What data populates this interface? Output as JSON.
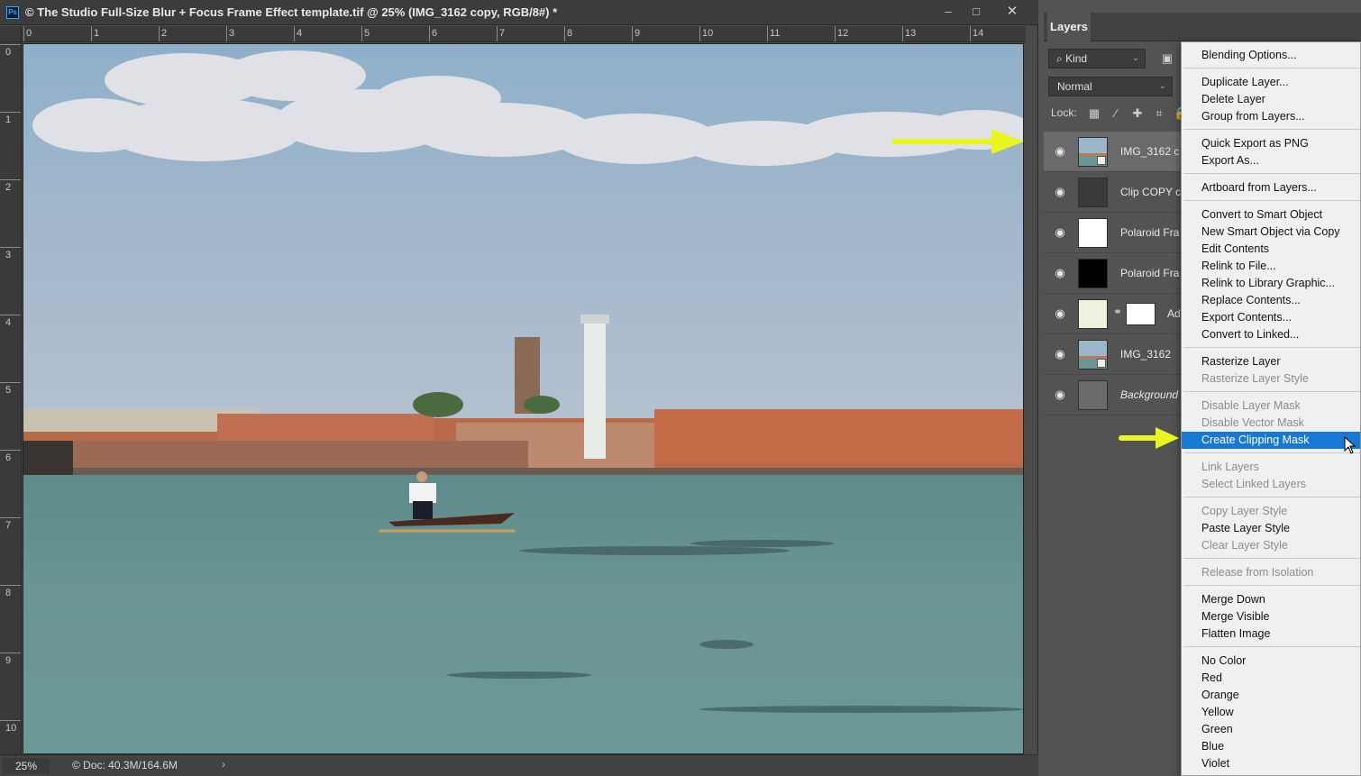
{
  "window": {
    "title": "© The Studio Full-Size Blur + Focus Frame Effect template.tif @ 25% (IMG_3162 copy, RGB/8#) *",
    "app_icon": "ps-app-icon",
    "controls": [
      "minimize-icon",
      "maximize-icon",
      "close-icon"
    ]
  },
  "rulers": {
    "horizontal": [
      "0",
      "1",
      "2",
      "3",
      "4",
      "5",
      "6",
      "7",
      "8",
      "9",
      "10",
      "11",
      "12",
      "13",
      "14"
    ],
    "vertical": [
      "0",
      "1",
      "2",
      "3",
      "4",
      "5",
      "6",
      "7",
      "8",
      "9",
      "10"
    ]
  },
  "status": {
    "zoom": "25%",
    "doc_info": "© Doc: 40.3M/164.6M",
    "expand_arrow": "›"
  },
  "panel": {
    "tab": "Layers",
    "filter_kind": "Kind",
    "filter_icon": "⌕",
    "blend_mode": "Normal",
    "lock_label": "Lock:",
    "lock_icons": [
      "lock-transparent-icon",
      "lock-paint-icon",
      "lock-move-icon",
      "lock-artboard-icon",
      "lock-all-icon"
    ]
  },
  "layers": [
    {
      "name": "IMG_3162 c",
      "selected": true,
      "thumb": "photo",
      "italic": false
    },
    {
      "name": "Clip COPY c",
      "selected": false,
      "thumb": "dark-text",
      "italic": false
    },
    {
      "name": "Polaroid Fra",
      "selected": false,
      "thumb": "white",
      "italic": false
    },
    {
      "name": "Polaroid Fra",
      "selected": false,
      "thumb": "black",
      "italic": false
    },
    {
      "name": "Ad",
      "selected": false,
      "thumb": "adjustment",
      "italic": false
    },
    {
      "name": "IMG_3162",
      "selected": false,
      "thumb": "photo",
      "italic": false
    },
    {
      "name": "Background",
      "selected": false,
      "thumb": "gray",
      "italic": true
    }
  ],
  "context_menu": {
    "groups": [
      [
        {
          "label": "Blending Options...",
          "enabled": true
        }
      ],
      [
        {
          "label": "Duplicate Layer...",
          "enabled": true
        },
        {
          "label": "Delete Layer",
          "enabled": true
        },
        {
          "label": "Group from Layers...",
          "enabled": true
        }
      ],
      [
        {
          "label": "Quick Export as PNG",
          "enabled": true
        },
        {
          "label": "Export As...",
          "enabled": true
        }
      ],
      [
        {
          "label": "Artboard from Layers...",
          "enabled": true
        }
      ],
      [
        {
          "label": "Convert to Smart Object",
          "enabled": true
        },
        {
          "label": "New Smart Object via Copy",
          "enabled": true
        },
        {
          "label": "Edit Contents",
          "enabled": true
        },
        {
          "label": "Relink to File...",
          "enabled": true
        },
        {
          "label": "Relink to Library Graphic...",
          "enabled": true
        },
        {
          "label": "Replace Contents...",
          "enabled": true
        },
        {
          "label": "Export Contents...",
          "enabled": true
        },
        {
          "label": "Convert to Linked...",
          "enabled": true
        }
      ],
      [
        {
          "label": "Rasterize Layer",
          "enabled": true
        },
        {
          "label": "Rasterize Layer Style",
          "enabled": false
        }
      ],
      [
        {
          "label": "Disable Layer Mask",
          "enabled": false
        },
        {
          "label": "Disable Vector Mask",
          "enabled": false
        },
        {
          "label": "Create Clipping Mask",
          "enabled": true,
          "highlighted": true
        }
      ],
      [
        {
          "label": "Link Layers",
          "enabled": false
        },
        {
          "label": "Select Linked Layers",
          "enabled": false
        }
      ],
      [
        {
          "label": "Copy Layer Style",
          "enabled": false
        },
        {
          "label": "Paste Layer Style",
          "enabled": true
        },
        {
          "label": "Clear Layer Style",
          "enabled": false
        }
      ],
      [
        {
          "label": "Release from Isolation",
          "enabled": false
        }
      ],
      [
        {
          "label": "Merge Down",
          "enabled": true
        },
        {
          "label": "Merge Visible",
          "enabled": true
        },
        {
          "label": "Flatten Image",
          "enabled": true
        }
      ],
      [
        {
          "label": "No Color",
          "enabled": true
        },
        {
          "label": "Red",
          "enabled": true
        },
        {
          "label": "Orange",
          "enabled": true
        },
        {
          "label": "Yellow",
          "enabled": true
        },
        {
          "label": "Green",
          "enabled": true
        },
        {
          "label": "Blue",
          "enabled": true
        },
        {
          "label": "Violet",
          "enabled": true
        }
      ]
    ]
  },
  "annotations": {
    "arrow_color": "#e8f51f"
  },
  "colors": {
    "menu_highlight": "#1879d5",
    "panel_bg": "#535353",
    "selected_layer": "#6a6a6a"
  }
}
